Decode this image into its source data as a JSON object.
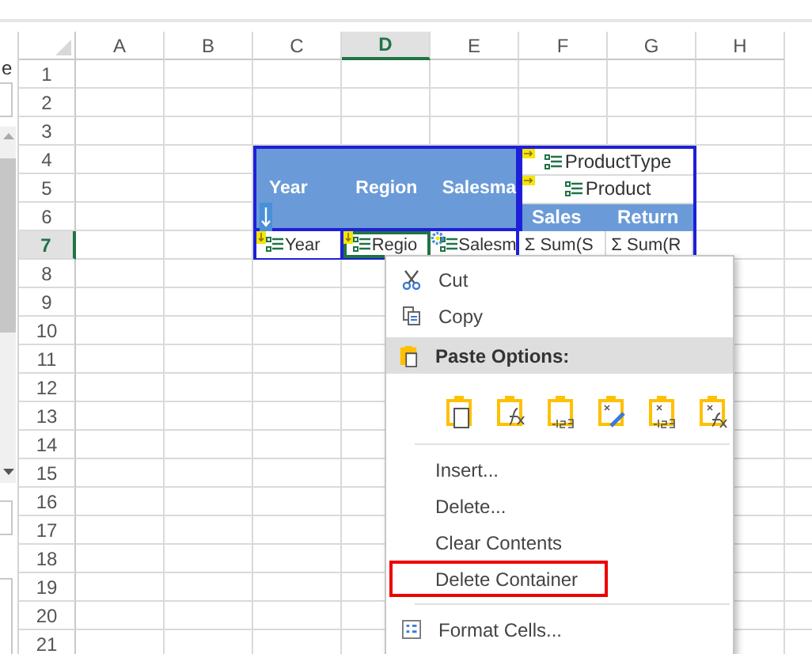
{
  "side_panel": {
    "label": "e"
  },
  "columns": [
    {
      "label": "A",
      "selected": false
    },
    {
      "label": "B",
      "selected": false
    },
    {
      "label": "C",
      "selected": false
    },
    {
      "label": "D",
      "selected": true
    },
    {
      "label": "E",
      "selected": false
    },
    {
      "label": "F",
      "selected": false
    },
    {
      "label": "G",
      "selected": false
    },
    {
      "label": "H",
      "selected": false
    }
  ],
  "rows": [
    {
      "label": "1",
      "selected": false
    },
    {
      "label": "2",
      "selected": false
    },
    {
      "label": "3",
      "selected": false
    },
    {
      "label": "4",
      "selected": false
    },
    {
      "label": "5",
      "selected": false
    },
    {
      "label": "6",
      "selected": false
    },
    {
      "label": "7",
      "selected": true
    },
    {
      "label": "8",
      "selected": false
    },
    {
      "label": "9",
      "selected": false
    },
    {
      "label": "10",
      "selected": false
    },
    {
      "label": "11",
      "selected": false
    },
    {
      "label": "12",
      "selected": false
    },
    {
      "label": "13",
      "selected": false
    },
    {
      "label": "14",
      "selected": false
    },
    {
      "label": "15",
      "selected": false
    },
    {
      "label": "16",
      "selected": false
    },
    {
      "label": "17",
      "selected": false
    },
    {
      "label": "18",
      "selected": false
    },
    {
      "label": "19",
      "selected": false
    },
    {
      "label": "20",
      "selected": false
    },
    {
      "label": "21",
      "selected": false
    }
  ],
  "pivot": {
    "row_headers": [
      "Year",
      "Region",
      "Salesma"
    ],
    "column_fields": [
      "ProductType",
      "Product"
    ],
    "value_headers": [
      "Sales",
      "Return"
    ],
    "row_fields": [
      {
        "label": "Year",
        "selected": false
      },
      {
        "label": "Regio",
        "selected": true
      },
      {
        "label": "Salesm",
        "selected": false
      }
    ],
    "value_fields": [
      "Σ Sum(S",
      "Σ Sum(R"
    ]
  },
  "context_menu": [
    {
      "kind": "cut",
      "label": "Cut"
    },
    {
      "kind": "copy",
      "label": "Copy"
    },
    {
      "kind": "header",
      "label": "Paste Options:"
    },
    {
      "kind": "paste_options"
    },
    {
      "kind": "separator"
    },
    {
      "kind": "command",
      "label": "Insert...",
      "outlined": false
    },
    {
      "kind": "command",
      "label": "Delete...",
      "outlined": false
    },
    {
      "kind": "command",
      "label": "Clear Contents",
      "outlined": false
    },
    {
      "kind": "command",
      "label": "Delete Container",
      "outlined": true
    },
    {
      "kind": "separator"
    },
    {
      "kind": "format",
      "label": "Format Cells..."
    }
  ]
}
